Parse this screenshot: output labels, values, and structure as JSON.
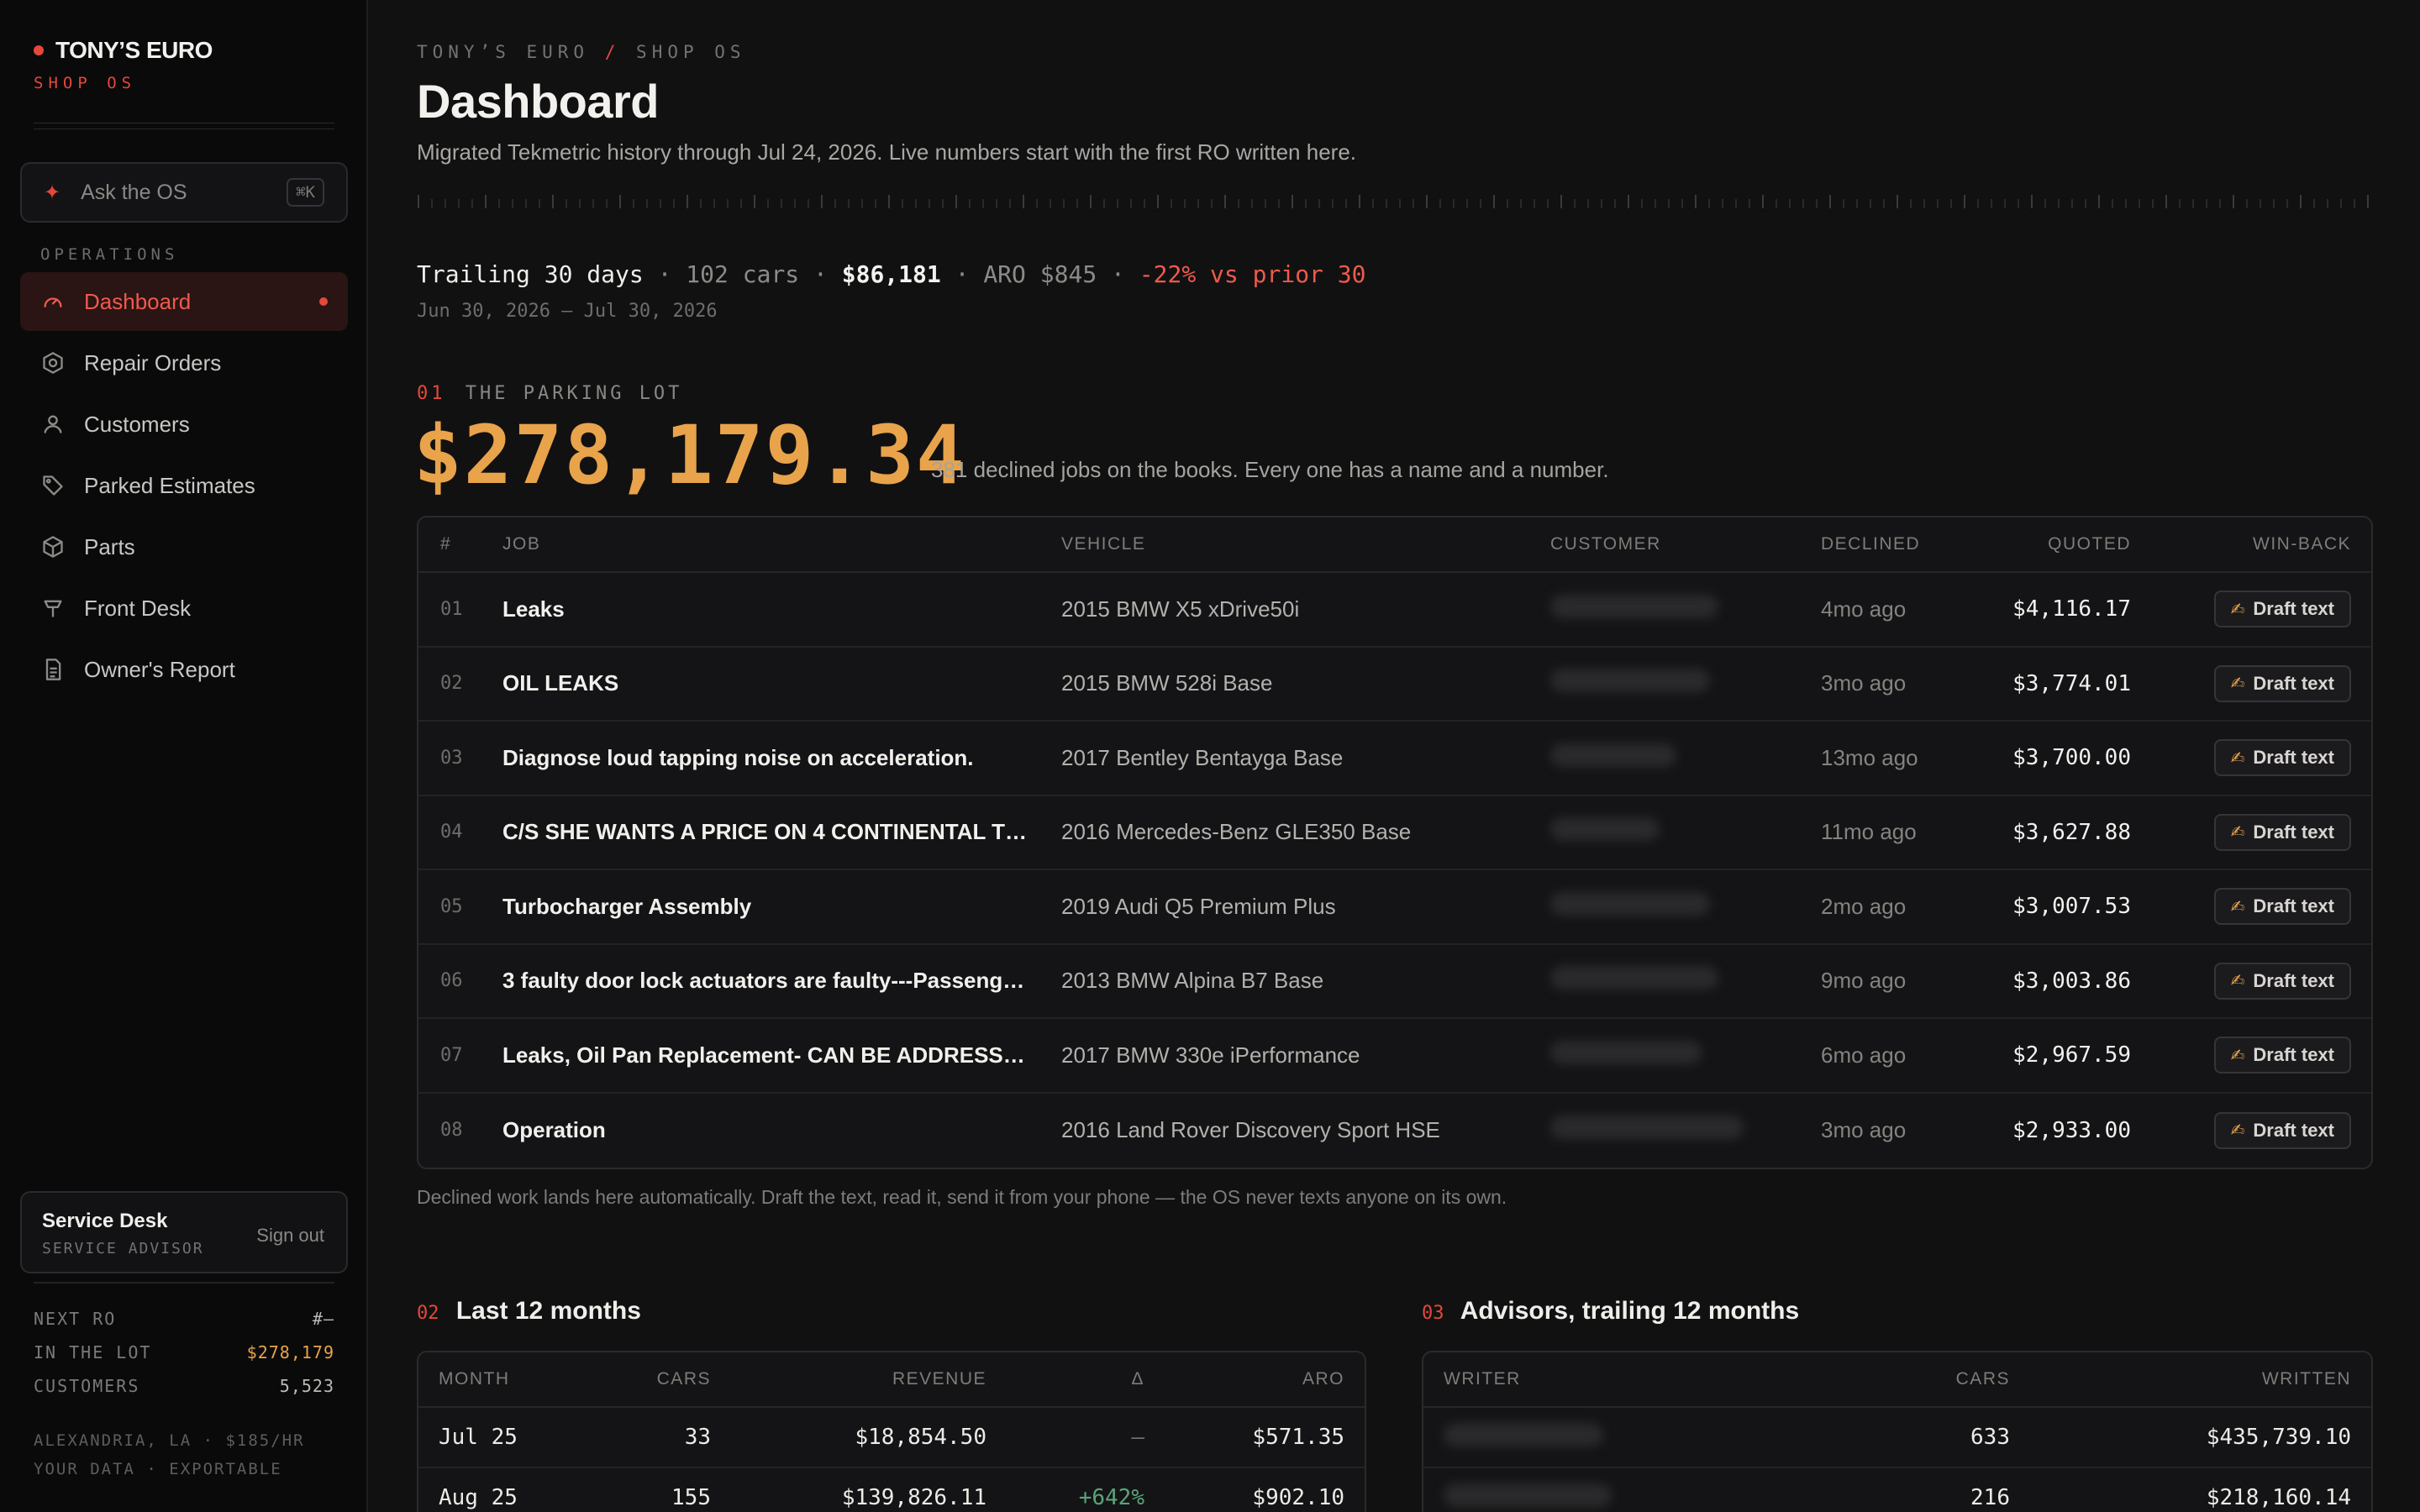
{
  "brand": {
    "name": "TONY’S EURO",
    "sub": "SHOP OS"
  },
  "ask": {
    "label": "Ask the OS",
    "shortcut": "⌘K"
  },
  "nav": {
    "heading": "OPERATIONS",
    "items": [
      {
        "label": "Dashboard",
        "icon": "gauge-icon",
        "active": true
      },
      {
        "label": "Repair Orders",
        "icon": "gear-icon"
      },
      {
        "label": "Customers",
        "icon": "user-icon"
      },
      {
        "label": "Parked Estimates",
        "icon": "tag-icon"
      },
      {
        "label": "Parts",
        "icon": "box-icon"
      },
      {
        "label": "Front Desk",
        "icon": "bell-icon"
      },
      {
        "label": "Owner's Report",
        "icon": "document-icon"
      }
    ]
  },
  "desk": {
    "name": "Service Desk",
    "role": "SERVICE ADVISOR",
    "signout": "Sign out"
  },
  "stats": [
    {
      "label": "NEXT RO",
      "value": "#—"
    },
    {
      "label": "IN THE LOT",
      "value": "$278,179"
    },
    {
      "label": "CUSTOMERS",
      "value": "5,523"
    }
  ],
  "footer": {
    "line1": "ALEXANDRIA, LA · $185/HR",
    "line2": "YOUR DATA · EXPORTABLE"
  },
  "header": {
    "crumb_a": "TONY’S EURO",
    "crumb_sep": "/",
    "crumb_b": "SHOP OS",
    "title": "Dashboard",
    "subtitle": "Migrated Tekmetric history through Jul 24, 2026. Live numbers start with the first RO written here."
  },
  "trailing": {
    "label": "Trailing 30 days",
    "cars": "102 cars",
    "revenue": "$86,181",
    "aro": "ARO $845",
    "change": "-22% vs prior 30",
    "dates": "Jun 30, 2026 – Jul 30, 2026"
  },
  "parking": {
    "num": "01",
    "label": "THE PARKING LOT",
    "amount": "$278,179.34",
    "note": "381 declined jobs on the books. Every one has a name and a number.",
    "columns": {
      "num": "#",
      "job": "JOB",
      "vehicle": "VEHICLE",
      "customer": "CUSTOMER",
      "declined": "DECLINED",
      "quoted": "QUOTED",
      "winback": "WIN-BACK"
    },
    "rows": [
      {
        "num": "01",
        "job": "Leaks",
        "vehicle": "2015 BMW X5 xDrive50i",
        "declined": "4mo ago",
        "quoted": "$4,116.17",
        "action": "Draft text"
      },
      {
        "num": "02",
        "job": "OIL LEAKS",
        "vehicle": "2015 BMW 528i Base",
        "declined": "3mo ago",
        "quoted": "$3,774.01",
        "action": "Draft text"
      },
      {
        "num": "03",
        "job": "Diagnose loud tapping noise on acceleration.",
        "vehicle": "2017 Bentley Bentayga Base",
        "declined": "13mo ago",
        "quoted": "$3,700.00",
        "action": "Draft text"
      },
      {
        "num": "04",
        "job": "C/S SHE WANTS A PRICE ON 4 CONTINENTAL TIR...",
        "vehicle": "2016 Mercedes-Benz GLE350 Base",
        "declined": "11mo ago",
        "quoted": "$3,627.88",
        "action": "Draft text"
      },
      {
        "num": "05",
        "job": "Turbocharger Assembly",
        "vehicle": "2019 Audi Q5 Premium Plus",
        "declined": "2mo ago",
        "quoted": "$3,007.53",
        "action": "Draft text"
      },
      {
        "num": "06",
        "job": "3 faulty door lock actuators are faulty---Passenge...",
        "vehicle": "2013 BMW Alpina B7 Base",
        "declined": "9mo ago",
        "quoted": "$3,003.86",
        "action": "Draft text"
      },
      {
        "num": "07",
        "job": "Leaks, Oil Pan Replacement- CAN BE ADDRESSED...",
        "vehicle": "2017 BMW 330e iPerformance",
        "declined": "6mo ago",
        "quoted": "$2,967.59",
        "action": "Draft text"
      },
      {
        "num": "08",
        "job": "Operation",
        "vehicle": "2016 Land Rover Discovery Sport HSE",
        "declined": "3mo ago",
        "quoted": "$2,933.00",
        "action": "Draft text"
      }
    ],
    "footnote": "Declined work lands here automatically. Draft the text, read it, send it from your phone — the OS never texts anyone on its own."
  },
  "months": {
    "num": "02",
    "title": "Last 12 months",
    "columns": {
      "month": "MONTH",
      "cars": "CARS",
      "revenue": "REVENUE",
      "delta": "Δ",
      "aro": "ARO"
    },
    "rows": [
      {
        "month": "Jul 25",
        "cars": "33",
        "revenue": "$18,854.50",
        "delta": "—",
        "aro": "$571.35"
      },
      {
        "month": "Aug 25",
        "cars": "155",
        "revenue": "$139,826.11",
        "delta": "+642%",
        "aro": "$902.10"
      }
    ]
  },
  "advisors": {
    "num": "03",
    "title": "Advisors, trailing 12 months",
    "columns": {
      "writer": "WRITER",
      "cars": "CARS",
      "written": "WRITTEN"
    },
    "rows": [
      {
        "cars": "633",
        "written": "$435,739.10"
      },
      {
        "cars": "216",
        "written": "$218,160.14"
      }
    ]
  }
}
